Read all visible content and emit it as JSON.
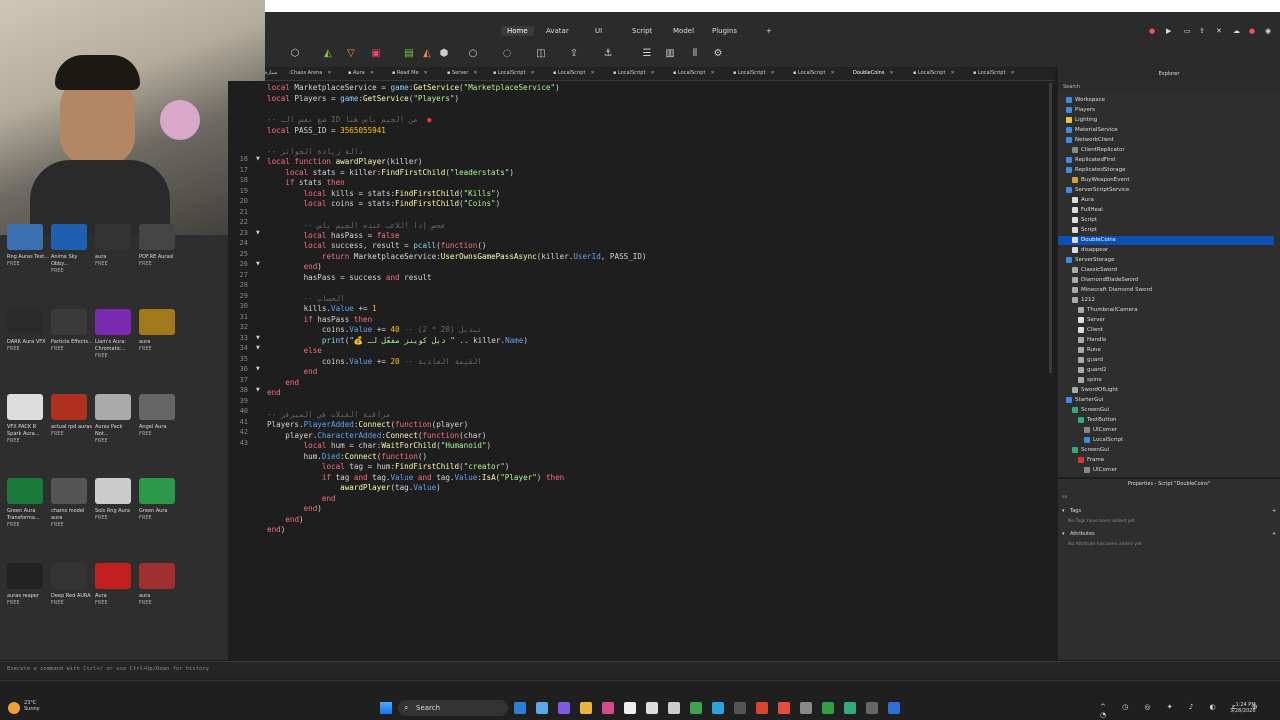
{
  "ribbon": {
    "tabs": [
      "Home",
      "Avatar",
      "UI",
      "Script",
      "Model",
      "Plugins"
    ]
  },
  "doc_tabs": [
    "سيارة",
    ":Chaos Arena",
    "Aura",
    "Read Me",
    "Server",
    "LocalScript",
    "LocalScript",
    "LocalScript",
    "LocalScript",
    "LocalScript",
    "LocalScript",
    "DoubleCoins",
    "LocalScript",
    "LocalScript"
  ],
  "toolbox": {
    "items": [
      [
        "Rng Auras Test...",
        "FREE"
      ],
      [
        "Anime Sky Obby...",
        "FREE"
      ],
      [
        "aura",
        "FREE"
      ],
      [
        "POF.RE Aurasl",
        "FREE"
      ],
      [
        "DARK Aura VFX",
        "FREE"
      ],
      [
        "Particle Effects...",
        "FREE"
      ],
      [
        "Liam's Aura: Chromatic...",
        "FREE"
      ],
      [
        "aura",
        "FREE"
      ],
      [
        "VFX PACK R Spark Aura...",
        "FREE"
      ],
      [
        "actual rpd auras",
        "FREE"
      ],
      [
        "Auras Pack Not...",
        "FREE"
      ],
      [
        "Angel Aura",
        "FREE"
      ],
      [
        "Green Aura Transforma...",
        "FREE"
      ],
      [
        "chains model aura",
        "FREE"
      ],
      [
        "Sols Rng Aura",
        "FREE"
      ],
      [
        "Green Aura",
        "FREE"
      ],
      [
        "auras reaper",
        "FREE"
      ],
      [
        "Deep Red AURA",
        "FREE"
      ],
      [
        "Aura",
        "FREE"
      ],
      [
        "aura",
        "FREE"
      ]
    ]
  },
  "editor": {
    "line_numbers": [
      "16",
      "17",
      "18",
      "19",
      "20",
      "21",
      "22",
      "23",
      "24",
      "25",
      "26",
      "27",
      "28",
      "29",
      "30",
      "31",
      "32",
      "33",
      "34",
      "35",
      "36",
      "37",
      "38",
      "39",
      "40",
      "41",
      "42",
      "43"
    ],
    "visible_start_line": 16
  },
  "explorer": {
    "title": "Explorer",
    "search": "Search",
    "items": [
      "Workspace",
      "Players",
      "Lighting",
      "MaterialService",
      "NetworkClient",
      "ClientReplicator",
      "ReplicatedFirst",
      "ReplicatedStorage",
      "BuyWeaponEvent",
      "ServerScriptService",
      "Aura",
      "FullHeal",
      "Script",
      "Script",
      "DoubleCoins",
      "disappear",
      "ServerStorage",
      "ClassicSword",
      "DiamondBladeSword",
      "Minecraft Diamond Sword",
      "1212",
      "ThumbnailCamera",
      "Server",
      "Client",
      "Handle",
      "Rune",
      "guard",
      "guard2",
      "spine",
      "SwordOfLight",
      "StarterGui",
      "ScreenGui",
      "TextButton",
      "UICorner",
      "LocalScript",
      "ScreenGui",
      "Frame",
      "UICorner"
    ],
    "selected": "DoubleCoins"
  },
  "properties": {
    "title": "Properties - Script \"DoubleCoins\"",
    "filter": "ss",
    "tags_header": "Tags",
    "tags_empty": "No Tags have been added yet",
    "attrs_header": "Attributes",
    "attrs_empty": "No Attribute has been added yet"
  },
  "command_bar": {
    "placeholder": "Execute a command with Ctrl+/ or use Ctrl+Up/Down for history"
  },
  "taskbar": {
    "search": "Search",
    "weather_temp": "23°C",
    "weather_desc": "Sunny",
    "time": "1:24 PM",
    "date": "3/28/2026"
  }
}
